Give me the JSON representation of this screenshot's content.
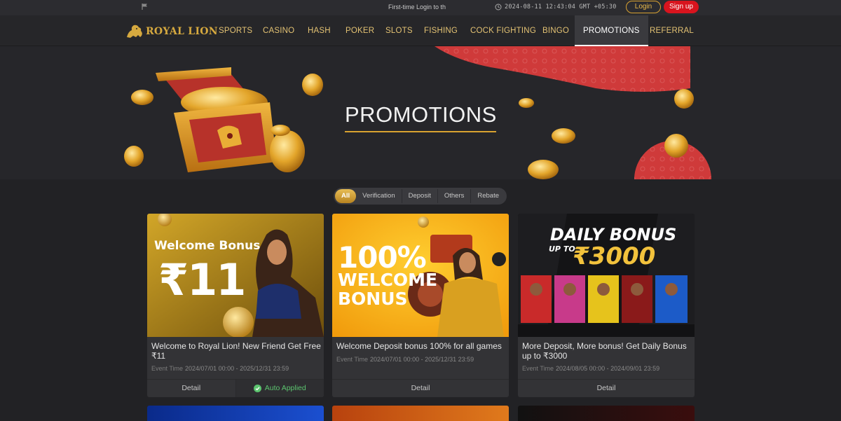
{
  "topbar": {
    "marquee": "First-time Login to th",
    "time": "2024-08-11 12:43:04 GMT +05:30",
    "login_label": "Login",
    "signup_label": "Sign up"
  },
  "nav": {
    "logo_text": "ROYAL LION",
    "items": [
      "SPORTS",
      "CASINO",
      "HASH",
      "POKER",
      "SLOTS",
      "FISHING",
      "COCK FIGHTING",
      "BINGO",
      "PROMOTIONS",
      "REFERRAL"
    ],
    "active": "PROMOTIONS"
  },
  "banner": {
    "title": "PROMOTIONS"
  },
  "filters": [
    "All",
    "Verification",
    "Deposit",
    "Others",
    "Rebate"
  ],
  "cards": [
    {
      "img_line1": "Welcome Bonus",
      "img_line2": "₹11",
      "title": "Welcome to Royal Lion! New Friend Get Free ₹11",
      "time_label": "Event Time",
      "time": "2024/07/01 00:00 - 2025/12/31 23:59",
      "detail_label": "Detail",
      "applied_label": "Auto Applied"
    },
    {
      "img_line1": "100%",
      "img_line2": "WELCOME",
      "img_line3": "BONUS",
      "title": "Welcome Deposit bonus 100% for all games",
      "time_label": "Event Time",
      "time": "2024/07/01 00:00 - 2025/12/31 23:59",
      "detail_label": "Detail"
    },
    {
      "img_line1": "DAILY BONUS",
      "img_line2": "UP TO",
      "img_line3": "₹3000",
      "title": "More Deposit, More bonus! Get Daily Bonus up to ₹3000",
      "time_label": "Event Time",
      "time": "2024/08/05 00:00 - 2024/09/01 23:59",
      "detail_label": "Detail"
    }
  ],
  "colors": {
    "accent": "#d9a230",
    "signup": "#d8141e",
    "applied": "#5cc46f"
  }
}
